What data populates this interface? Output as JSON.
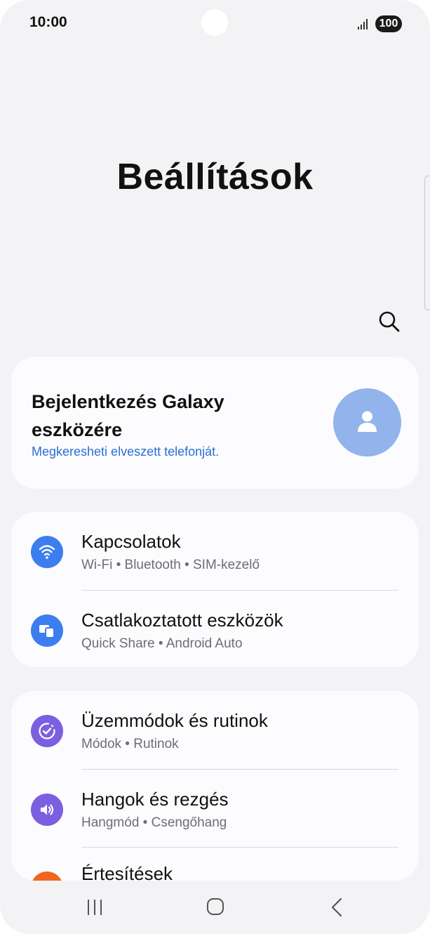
{
  "status_bar": {
    "time": "10:00",
    "battery": "100",
    "signal_icon": "signal-bars-icon"
  },
  "header": {
    "title": "Beállítások",
    "search_icon": "search-icon"
  },
  "account": {
    "title": "Bejelentkezés Galaxy eszközére",
    "subtitle": "Megkeresheti elveszett telefonját.",
    "avatar_icon": "person-icon",
    "avatar_color": "#92b3ec"
  },
  "groups": [
    {
      "items": [
        {
          "title": "Kapcsolatok",
          "subtitle": "Wi-Fi  •  Bluetooth  •  SIM-kezelő",
          "icon": "wifi-icon",
          "color": "#3c7ef0"
        },
        {
          "title": "Csatlakoztatott eszközök",
          "subtitle": "Quick Share  •  Android Auto",
          "icon": "connected-devices-icon",
          "color": "#3c7ef0"
        }
      ]
    },
    {
      "items": [
        {
          "title": "Üzemmódok és rutinok",
          "subtitle": "Módok  •  Rutinok",
          "icon": "modes-check-icon",
          "color": "#7b5fe0"
        },
        {
          "title": "Hangok és rezgés",
          "subtitle": "Hangmód  •  Csengőhang",
          "icon": "speaker-icon",
          "color": "#7b5fe0"
        },
        {
          "title": "Értesítések",
          "subtitle": "",
          "icon": "notification-icon",
          "color": "#f0661f"
        }
      ]
    }
  ],
  "nav_bar": {
    "recents_icon": "recents-icon",
    "home_icon": "home-icon",
    "back_icon": "back-icon"
  }
}
